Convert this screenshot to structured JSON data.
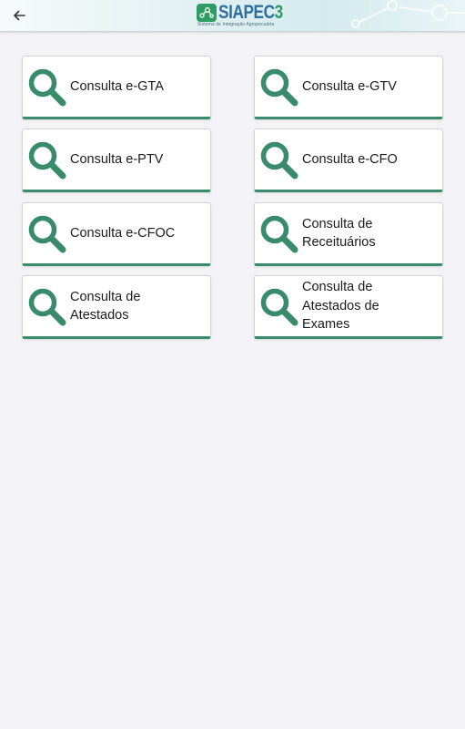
{
  "header": {
    "logo_name_prefix": "SIAPEC",
    "logo_name_suffix": "3",
    "logo_subtitle": "Sistema de Integração Agropecuária",
    "colors": {
      "brand_green": "#2e9c63",
      "brand_blue": "#2f6f9e"
    }
  },
  "accent_color": "#3a8b6c",
  "cards": [
    {
      "label": "Consulta e-GTA"
    },
    {
      "label": "Consulta e-GTV"
    },
    {
      "label": "Consulta e-PTV"
    },
    {
      "label": "Consulta e-CFO"
    },
    {
      "label": "Consulta e-CFOC"
    },
    {
      "label": "Consulta de\nReceituários"
    },
    {
      "label": "Consulta de\nAtestados"
    },
    {
      "label": "Consulta de\nAtestados de\nExames"
    }
  ]
}
